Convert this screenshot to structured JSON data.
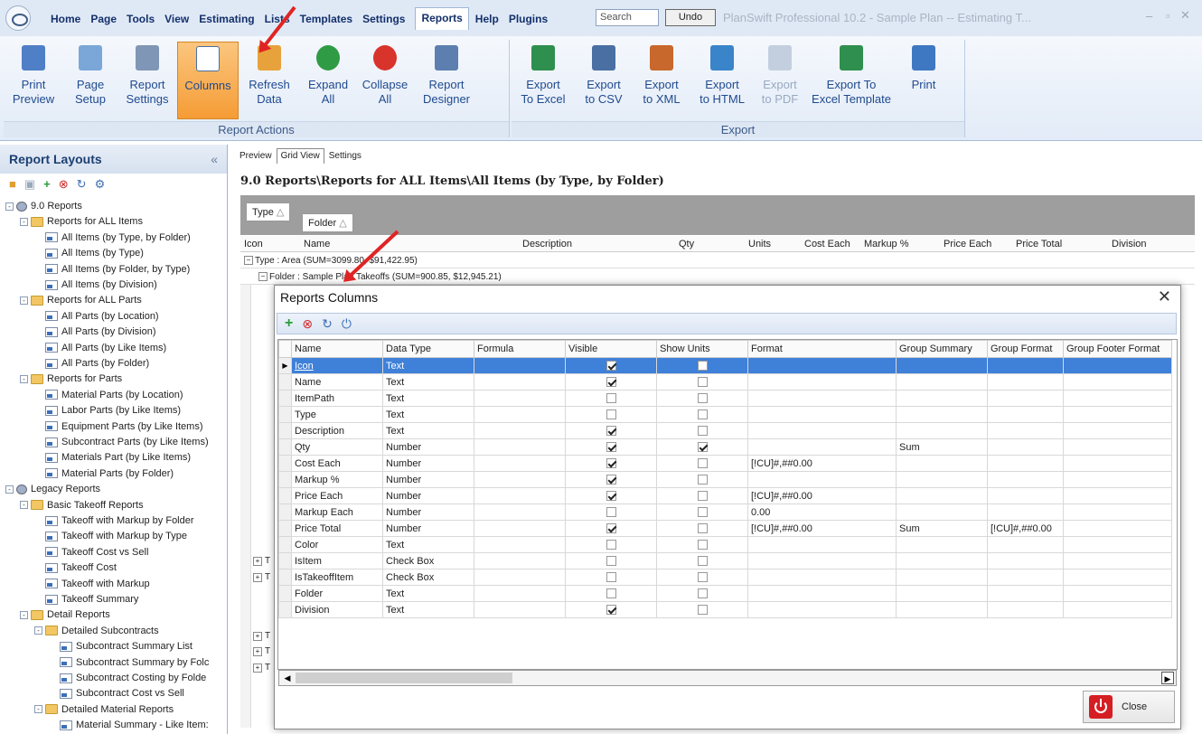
{
  "menu": {
    "items": [
      "Home",
      "Page",
      "Tools",
      "View",
      "Estimating",
      "Lists",
      "Templates",
      "Settings",
      "Reports",
      "Help",
      "Plugins"
    ],
    "active_index": 8
  },
  "search": {
    "placeholder": "Search"
  },
  "undo_label": "Undo",
  "app_title": "PlanSwift Professional 10.2 - Sample Plan -- Estimating T...",
  "ribbon": {
    "report_actions": {
      "label": "Report Actions",
      "buttons": [
        {
          "label": "Print\nPreview",
          "icon": "print-preview-icon"
        },
        {
          "label": "Page\nSetup",
          "icon": "page-setup-icon"
        },
        {
          "label": "Report\nSettings",
          "icon": "report-settings-icon"
        },
        {
          "label": "Columns",
          "icon": "columns-icon",
          "active": true
        },
        {
          "label": "Refresh\nData",
          "icon": "refresh-data-icon"
        },
        {
          "label": "Expand\nAll",
          "icon": "expand-all-icon"
        },
        {
          "label": "Collapse\nAll",
          "icon": "collapse-all-icon"
        },
        {
          "label": "Report\nDesigner",
          "icon": "report-designer-icon"
        }
      ]
    },
    "export": {
      "label": "Export",
      "buttons": [
        {
          "label": "Export\nTo Excel",
          "icon": "export-excel-icon"
        },
        {
          "label": "Export\nto CSV",
          "icon": "export-csv-icon"
        },
        {
          "label": "Export\nto XML",
          "icon": "export-xml-icon"
        },
        {
          "label": "Export\nto HTML",
          "icon": "export-html-icon"
        },
        {
          "label": "Export\nto PDF",
          "icon": "export-pdf-icon",
          "disabled": true
        },
        {
          "label": "Export To\nExcel Template",
          "icon": "export-excel-template-icon"
        },
        {
          "label": "Print",
          "icon": "print-icon"
        }
      ]
    }
  },
  "left_panel": {
    "title": "Report Layouts",
    "collapse": "«",
    "tree": [
      {
        "label": "9.0 Reports",
        "level": 0,
        "kind": "globe",
        "exp": "-"
      },
      {
        "label": "Reports for ALL Items",
        "level": 1,
        "kind": "folder",
        "exp": "-"
      },
      {
        "label": "All Items (by Type, by Folder)",
        "level": 2,
        "kind": "report"
      },
      {
        "label": "All Items (by Type)",
        "level": 2,
        "kind": "report"
      },
      {
        "label": "All Items (by Folder, by Type)",
        "level": 2,
        "kind": "report"
      },
      {
        "label": "All Items (by Division)",
        "level": 2,
        "kind": "report"
      },
      {
        "label": "Reports for ALL Parts",
        "level": 1,
        "kind": "folder",
        "exp": "-"
      },
      {
        "label": "All Parts (by Location)",
        "level": 2,
        "kind": "report"
      },
      {
        "label": "All Parts (by Division)",
        "level": 2,
        "kind": "report"
      },
      {
        "label": "All Parts (by Like Items)",
        "level": 2,
        "kind": "report"
      },
      {
        "label": "All Parts (by Folder)",
        "level": 2,
        "kind": "report"
      },
      {
        "label": "Reports for Parts",
        "level": 1,
        "kind": "folder",
        "exp": "-"
      },
      {
        "label": "Material Parts (by Location)",
        "level": 2,
        "kind": "report"
      },
      {
        "label": "Labor Parts (by Like Items)",
        "level": 2,
        "kind": "report"
      },
      {
        "label": "Equipment Parts (by Like Items)",
        "level": 2,
        "kind": "report"
      },
      {
        "label": "Subcontract Parts (by Like Items)",
        "level": 2,
        "kind": "report"
      },
      {
        "label": "Materials Part (by Like Items)",
        "level": 2,
        "kind": "report"
      },
      {
        "label": "Material Parts (by Folder)",
        "level": 2,
        "kind": "report"
      },
      {
        "label": "Legacy Reports",
        "level": 0,
        "kind": "globe",
        "exp": "-"
      },
      {
        "label": "Basic Takeoff Reports",
        "level": 1,
        "kind": "folder",
        "exp": "-"
      },
      {
        "label": "Takeoff with Markup by Folder",
        "level": 2,
        "kind": "report"
      },
      {
        "label": "Takeoff with Markup by Type",
        "level": 2,
        "kind": "report"
      },
      {
        "label": "Takeoff Cost vs Sell",
        "level": 2,
        "kind": "report"
      },
      {
        "label": "Takeoff Cost",
        "level": 2,
        "kind": "report"
      },
      {
        "label": "Takeoff with Markup",
        "level": 2,
        "kind": "report"
      },
      {
        "label": "Takeoff Summary",
        "level": 2,
        "kind": "report"
      },
      {
        "label": "Detail Reports",
        "level": 1,
        "kind": "folder",
        "exp": "-"
      },
      {
        "label": "Detailed Subcontracts",
        "level": 2,
        "kind": "folder",
        "exp": "-"
      },
      {
        "label": "Subcontract Summary List",
        "level": 3,
        "kind": "report"
      },
      {
        "label": "Subcontract Summary by Folc",
        "level": 3,
        "kind": "report"
      },
      {
        "label": "Subcontract Costing by Folde",
        "level": 3,
        "kind": "report"
      },
      {
        "label": "Subcontract Cost vs Sell",
        "level": 3,
        "kind": "report"
      },
      {
        "label": "Detailed Material Reports",
        "level": 2,
        "kind": "folder",
        "exp": "-"
      },
      {
        "label": "Material Summary - Like Item:",
        "level": 3,
        "kind": "report"
      }
    ]
  },
  "tabs": [
    "Preview",
    "Grid View",
    "Settings"
  ],
  "active_tab": 1,
  "breadcrumb": "9.0 Reports\\Reports for ALL Items\\All Items (by Type, by Folder)",
  "group_chips": [
    "Type",
    "Folder"
  ],
  "grid_columns": [
    "Icon",
    "Name",
    "Description",
    "Qty",
    "Units",
    "Cost Each",
    "Markup %",
    "Price Each",
    "Price Total",
    "Division"
  ],
  "grid_rows": [
    "Type : Area (SUM=3099.80, $91,422.95)",
    "Folder : Sample Plan Takeoffs (SUM=900.85, $12,945.21)"
  ],
  "grid_collapsed_rows": [
    "T",
    "T",
    "T",
    "T",
    "T"
  ],
  "dialog": {
    "title": "Reports Columns",
    "close_x": "✕",
    "columns": [
      "Name",
      "Data Type",
      "Formula",
      "Visible",
      "Show Units",
      "Format",
      "Group Summary",
      "Group Format",
      "Group Footer Format"
    ],
    "rows": [
      {
        "name": "Icon",
        "type": "Text",
        "formula": "",
        "visible": true,
        "show_units": false,
        "format": "",
        "group_summary": "",
        "group_format": "",
        "selected": true
      },
      {
        "name": "Name",
        "type": "Text",
        "formula": "",
        "visible": true,
        "show_units": false,
        "format": "",
        "group_summary": "",
        "group_format": ""
      },
      {
        "name": "ItemPath",
        "type": "Text",
        "formula": "",
        "visible": false,
        "show_units": false,
        "format": "",
        "group_summary": "",
        "group_format": ""
      },
      {
        "name": "Type",
        "type": "Text",
        "formula": "",
        "visible": false,
        "show_units": false,
        "format": "",
        "group_summary": "",
        "group_format": ""
      },
      {
        "name": "Description",
        "type": "Text",
        "formula": "",
        "visible": true,
        "show_units": false,
        "format": "",
        "group_summary": "",
        "group_format": ""
      },
      {
        "name": "Qty",
        "type": "Number",
        "formula": "",
        "visible": true,
        "show_units": true,
        "format": "",
        "group_summary": "Sum",
        "group_format": ""
      },
      {
        "name": "Cost Each",
        "type": "Number",
        "formula": "",
        "visible": true,
        "show_units": false,
        "format": "[!CU]#,##0.00",
        "group_summary": "",
        "group_format": ""
      },
      {
        "name": "Markup %",
        "type": "Number",
        "formula": "",
        "visible": true,
        "show_units": false,
        "format": "",
        "group_summary": "",
        "group_format": ""
      },
      {
        "name": "Price Each",
        "type": "Number",
        "formula": "",
        "visible": true,
        "show_units": false,
        "format": "[!CU]#,##0.00",
        "group_summary": "",
        "group_format": ""
      },
      {
        "name": "Markup Each",
        "type": "Number",
        "formula": "",
        "visible": false,
        "show_units": false,
        "format": "0.00",
        "group_summary": "",
        "group_format": ""
      },
      {
        "name": "Price Total",
        "type": "Number",
        "formula": "",
        "visible": true,
        "show_units": false,
        "format": "[!CU]#,##0.00",
        "group_summary": "Sum",
        "group_format": "[!CU]#,##0.00"
      },
      {
        "name": "Color",
        "type": "Text",
        "formula": "",
        "visible": false,
        "show_units": false,
        "format": "",
        "group_summary": "",
        "group_format": ""
      },
      {
        "name": "IsItem",
        "type": "Check Box",
        "formula": "",
        "visible": false,
        "show_units": false,
        "format": "",
        "group_summary": "",
        "group_format": ""
      },
      {
        "name": "IsTakeoffItem",
        "type": "Check Box",
        "formula": "",
        "visible": false,
        "show_units": false,
        "format": "",
        "group_summary": "",
        "group_format": ""
      },
      {
        "name": "Folder",
        "type": "Text",
        "formula": "",
        "visible": false,
        "show_units": false,
        "format": "",
        "group_summary": "",
        "group_format": ""
      },
      {
        "name": "Division",
        "type": "Text",
        "formula": "",
        "visible": true,
        "show_units": false,
        "format": "",
        "group_summary": "",
        "group_format": ""
      }
    ],
    "close_button": "Close"
  }
}
